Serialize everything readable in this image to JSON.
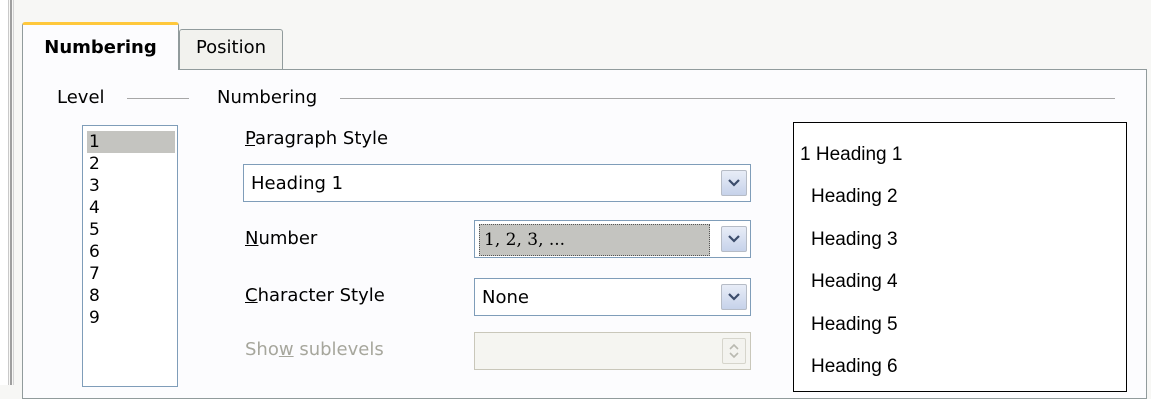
{
  "tabs": {
    "numbering": "Numbering",
    "position": "Position"
  },
  "level": {
    "legend": "Level",
    "items": [
      "1",
      "2",
      "3",
      "4",
      "5",
      "6",
      "7",
      "8",
      "9"
    ],
    "selected": "1"
  },
  "numbering": {
    "legend": "Numbering",
    "paragraph_style": {
      "label_mnemonic": "P",
      "label_rest": "aragraph Style",
      "value": "Heading 1"
    },
    "number": {
      "label_mnemonic": "N",
      "label_rest": "umber",
      "value": "1, 2, 3, ..."
    },
    "character_style": {
      "label_mnemonic": "C",
      "label_rest": "haracter Style",
      "value": "None"
    },
    "show_sublevels": {
      "label_pre": "Sho",
      "label_mnemonic": "w",
      "label_rest": " sublevels",
      "value": ""
    }
  },
  "preview": {
    "items": [
      "1 Heading 1",
      "Heading 2",
      "Heading 3",
      "Heading 4",
      "Heading 5",
      "Heading 6"
    ]
  },
  "colors": {
    "active_tab_accent": "#ffc83c",
    "selection": "#c4c4c0",
    "input_border": "#7f9db9"
  }
}
